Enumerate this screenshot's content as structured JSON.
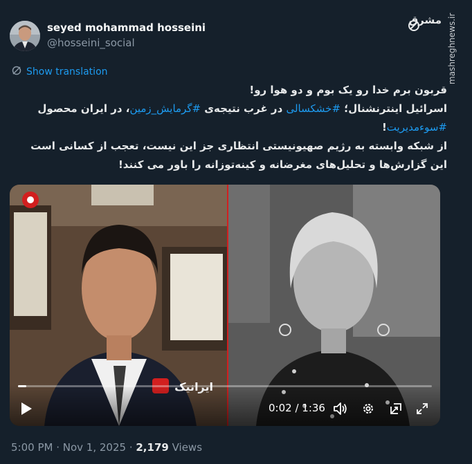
{
  "author": {
    "name": "seyed mohammad hosseini",
    "handle": "@hosseini_social"
  },
  "watermark": "mashreghnews.ir",
  "logo_text": "مشرق",
  "translate_label": "Show translation",
  "tweet": {
    "line1": "قربون برم خدا رو یک بوم و دو هوا رو!",
    "line2_a": "اسرائیل اینترنشنال؛ ",
    "tag1": "#خشکسالی",
    "line2_b": " در غرب نتیجه‌ی ",
    "tag2": "#گرمایش_زمین",
    "line2_c": "، در ایران محصول ",
    "tag3": "#سوءمدیریت",
    "line2_d": "!",
    "line3": "از شبکه وابسته به رژیم صهیونیستی انتظاری جز این نیست، تعجب از کسانی است این گزارش‌ها و تحلیل‌های مغرضانه و کینه‌توزانه را باور می کنند!"
  },
  "video": {
    "current_time": "0:02",
    "separator": " / ",
    "duration": "1:36",
    "progress_fraction": 0.02,
    "channel_logo": "ایرانیک",
    "accent": "#d21f1f"
  },
  "footer": {
    "time": "5:00 PM",
    "dot1": " · ",
    "date": "Nov 1, 2025",
    "dot2": " · ",
    "views_count": "2,179",
    "views_label": " Views"
  },
  "colors": {
    "background": "#15202b",
    "link": "#1d9bf0",
    "text": "#e7e9ea",
    "muted": "#8b98a5"
  }
}
